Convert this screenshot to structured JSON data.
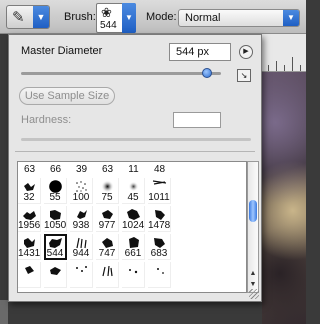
{
  "options_bar": {
    "brush_label": "Brush:",
    "brush_size": "544",
    "mode_label": "Mode:",
    "mode_value": "Normal"
  },
  "brush_panel": {
    "master_diameter_label": "Master Diameter",
    "master_diameter_value": "544 px",
    "diameter_slider_level": 0.93,
    "use_sample_size_label": "Use Sample Size",
    "hardness_label": "Hardness:",
    "hardness_value": "",
    "top_row_numbers": [
      "63",
      "66",
      "39",
      "63",
      "11",
      "48"
    ],
    "rows": [
      [
        "32",
        "55",
        "100",
        "75",
        "45",
        "1011"
      ],
      [
        "1956",
        "1050",
        "938",
        "977",
        "1024",
        "1478"
      ],
      [
        "1431",
        "544",
        "944",
        "747",
        "661",
        "683"
      ]
    ],
    "selected_brush": "544"
  },
  "icons": {
    "tool_preset": "brush-icon",
    "panel_menu": "play-arrow-icon",
    "restore": "restore-size-icon"
  },
  "colors": {
    "accent": "#2f6fd0",
    "panel_bg": "#e6e6e6"
  }
}
